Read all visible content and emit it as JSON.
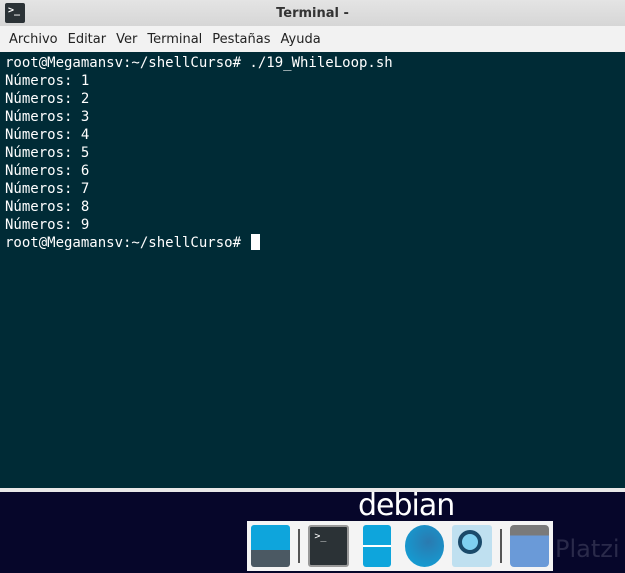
{
  "window": {
    "title": "Terminal -",
    "icon": "terminal-icon",
    "icon_text": ">_"
  },
  "menu": [
    "Archivo",
    "Editar",
    "Ver",
    "Terminal",
    "Pestañas",
    "Ayuda"
  ],
  "terminal": {
    "lines": [
      "root@Megamansv:~/shellCurso# ./19_WhileLoop.sh",
      "Números: 1",
      "Números: 2",
      "Números: 3",
      "Números: 4",
      "Números: 5",
      "Números: 6",
      "Números: 7",
      "Números: 8",
      "Números: 9"
    ],
    "prompt": "root@Megamansv:~/shellCurso# "
  },
  "desktop": {
    "logo": "debian",
    "watermark": "Platzi"
  },
  "dock": [
    "show-desktop-icon",
    "terminal-icon",
    "file-manager-icon",
    "web-browser-icon",
    "app-finder-icon",
    "folder-icon"
  ]
}
